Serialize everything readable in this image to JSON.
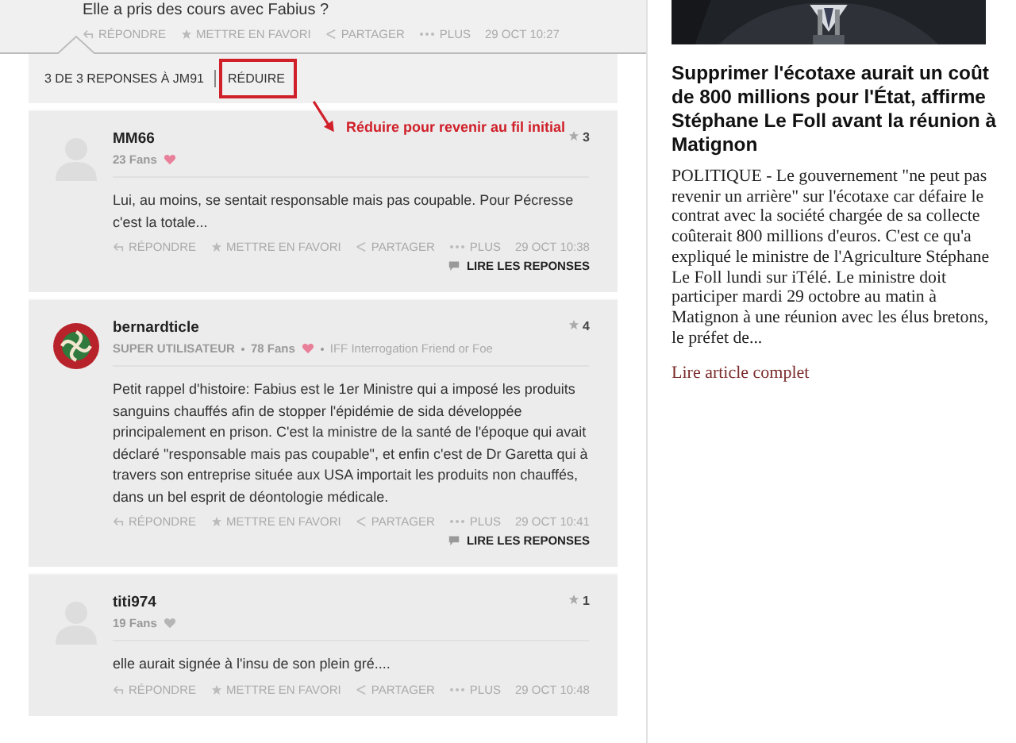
{
  "parent_comment": {
    "text": "Elle a pris des cours avec Fabius ?",
    "actions": [
      {
        "kind": "reply",
        "label": "RÉPONDRE"
      },
      {
        "kind": "favorite",
        "label": "METTRE EN FAVORI"
      },
      {
        "kind": "share",
        "label": "PARTAGER"
      },
      {
        "kind": "more",
        "label": "PLUS"
      }
    ],
    "date": "29 OCT 10:27"
  },
  "replies_header": {
    "count": "3 DE 3 REPONSES À JM91",
    "collapse": "RÉDUIRE"
  },
  "annotation": {
    "text": "Réduire pour revenir au fil initial"
  },
  "replies": [
    {
      "user": "MM66",
      "custom_avatar": false,
      "fans": "23 Fans",
      "heart_on": true,
      "likes": "3",
      "text": "Lui, au moins, se sentait responsable mais pas coupable. Pour Pécresse c'est la totale...",
      "actions": [
        {
          "kind": "reply",
          "label": "RÉPONDRE"
        },
        {
          "kind": "favorite",
          "label": "METTRE EN FAVORI"
        },
        {
          "kind": "share",
          "label": "PARTAGER"
        },
        {
          "kind": "more",
          "label": "PLUS"
        }
      ],
      "date": "29 OCT 10:38",
      "read_replies": "LIRE LES REPONSES"
    },
    {
      "user": "bernardticle",
      "custom_avatar": true,
      "role": "SUPER UTILISATEUR",
      "fans": "78 Fans",
      "heart_on": true,
      "signature": "IFF Interrogation Friend or Foe",
      "likes": "4",
      "text": "Petit rappel d'histoire: Fabius est le 1er Ministre qui a imposé les produits sanguins chauffés afin de stopper l'épidémie de sida développée principalement en prison. C'est la ministre de la santé de l'époque qui avait déclaré \"responsable mais pas coupable\", et enfin c'est de Dr Garetta qui à travers son entreprise située aux USA importait les produits non chauffés, dans un bel esprit de déontologie médicale.",
      "actions": [
        {
          "kind": "reply",
          "label": "RÉPONDRE"
        },
        {
          "kind": "favorite",
          "label": "METTRE EN FAVORI"
        },
        {
          "kind": "share",
          "label": "PARTAGER"
        },
        {
          "kind": "more",
          "label": "PLUS"
        }
      ],
      "date": "29 OCT 10:41",
      "read_replies": "LIRE LES REPONSES"
    },
    {
      "user": "titi974",
      "custom_avatar": false,
      "fans": "19 Fans",
      "heart_on": false,
      "likes": "1",
      "text": "elle aurait signée à l'insu de son plein gré....",
      "actions": [
        {
          "kind": "reply",
          "label": "RÉPONDRE"
        },
        {
          "kind": "favorite",
          "label": "METTRE EN FAVORI"
        },
        {
          "kind": "share",
          "label": "PARTAGER"
        },
        {
          "kind": "more",
          "label": "PLUS"
        }
      ],
      "date": "29 OCT 10:48"
    }
  ],
  "article": {
    "headline": "Supprimer l'écotaxe aurait un coût de 800 millions pour l'État, affirme Stéphane Le Foll avant la réunion à Matignon",
    "summary": "POLITIQUE - Le gouvernement \"ne peut pas revenir un arrière\" sur l'écotaxe car défaire le contrat avec la société chargée de sa collecte coûterait 800 millions d'euros. C'est ce qu'a expliqué le ministre de l'Agriculture Stéphane Le Foll lundi sur iTélé. Le ministre doit participer mardi 29 octobre au matin à Matignon à une réunion avec les élus bretons, le préfet de...",
    "link": "Lire article complet"
  }
}
